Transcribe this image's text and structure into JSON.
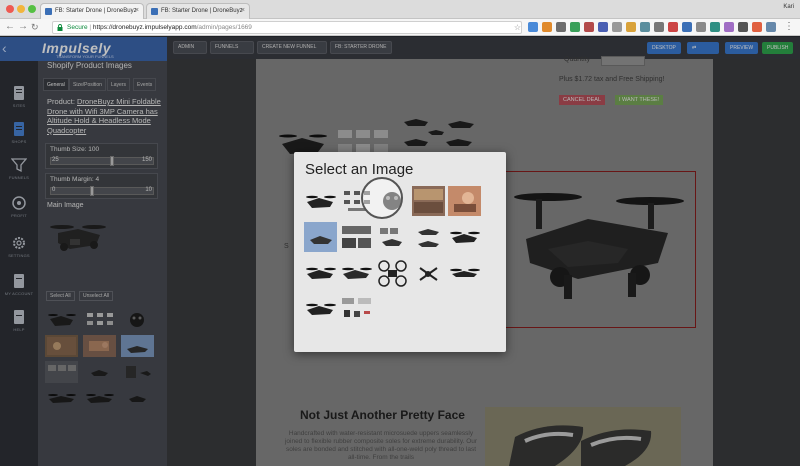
{
  "browser": {
    "tabs": [
      {
        "label": "FB: Starter Drone | DroneBuyz"
      },
      {
        "label": "FB: Starter Drone | DroneBuyz"
      }
    ],
    "user": "Kari",
    "url_secure": "Secure",
    "url_host": "https://dronebuyz.impulselyapp.com",
    "url_path": "/admin/pages/1669"
  },
  "brand": {
    "logo": "Impulsely",
    "tagline": "TRANSFORM YOUR FUNNELS"
  },
  "iconbar": [
    {
      "label": "SITES",
      "icon": "sites-icon"
    },
    {
      "label": "SHOPS",
      "icon": "shops-icon"
    },
    {
      "label": "FUNNELS",
      "icon": "funnel-icon"
    },
    {
      "label": "PROFIT",
      "icon": "profit-icon"
    },
    {
      "label": "SETTINGS",
      "icon": "settings-icon"
    },
    {
      "label": "MY ACCOUNT",
      "icon": "account-icon"
    },
    {
      "label": "HELP",
      "icon": "help-icon"
    }
  ],
  "panel": {
    "title": "Shopify Product Images",
    "tabs": [
      "General",
      "Size/Position",
      "Layers",
      "Events"
    ],
    "product_prefix": "Product: ",
    "product_name": "DroneBuyz Mini Foldable Drone with Wifi 3MP Camera has Altitude Hold & Headless Mode Quadcopter",
    "thumb_size_label": "Thumb Size: 100",
    "thumb_size_min": "25",
    "thumb_size_max": "150",
    "thumb_size": 100,
    "thumb_margin_label": "Thumb Margin: 4",
    "thumb_margin_min": "0",
    "thumb_margin_max": "10",
    "thumb_margin": 4,
    "main_image_label": "Main Image",
    "select_all": "Select All",
    "unselect_all": "Unselect All"
  },
  "toolbar": {
    "crumbs": [
      "ADMIN",
      "FUNNELS",
      "CREATE NEW FUNNEL",
      "FB: STARTER DRONE"
    ],
    "desktop": "DESKTOP",
    "preview": "PREVIEW",
    "publish": "PUBLISH"
  },
  "page": {
    "quantity": "Quantity",
    "shipping": "Plus $1.72 tax and Free Shipping!",
    "cancel_deal": "CANCEL DEAL",
    "want_these": "I WANT THESE!",
    "heading": "Not Just Another Pretty Face",
    "paragraph": "Handcrafted with water-resistant microsuede uppers seamlessly joined to flexible rubber composite soles for extreme durability. Our soles are bonded and stitched with all-one-weld poly thread to last all-time. From the trails"
  },
  "modal": {
    "title": "Select an Image"
  },
  "colors": {
    "brand_blue": "#3c68b0",
    "cancel_red": "#b8505b",
    "want_green": "#7aa85a",
    "publish_green": "#2fa84f",
    "toolbar_blue": "#3a7bd5"
  }
}
